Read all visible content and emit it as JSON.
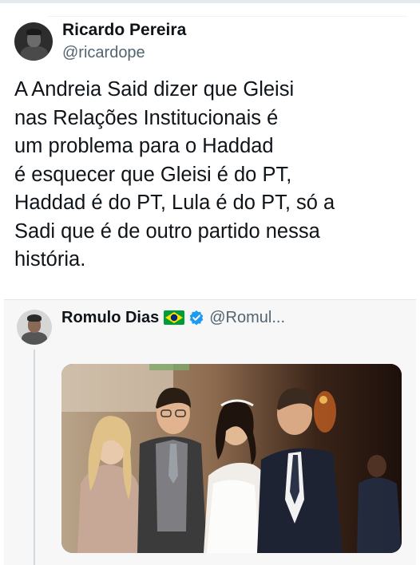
{
  "main_tweet": {
    "display_name": "Ricardo Pereira",
    "handle": "@ricardope",
    "text_lines": [
      "A Andreia Said dizer que Gleisi",
      "nas Relações Institucionais é",
      "um problema para o Haddad",
      "é esquecer que Gleisi é do PT,",
      "Haddad é do PT, Lula é do PT, só a",
      "Sadi que é de outro partido nessa",
      "história."
    ]
  },
  "quoted_tweet": {
    "display_name": "Romulo Dias",
    "flag_icon": "brazil-flag-icon",
    "verified_icon": "verified-badge-icon",
    "handle": "@Romul..."
  },
  "colors": {
    "text_primary": "#0f1419",
    "text_secondary": "#536471",
    "verified_blue": "#1d9bf0",
    "quote_background": "#f7f7f8"
  }
}
